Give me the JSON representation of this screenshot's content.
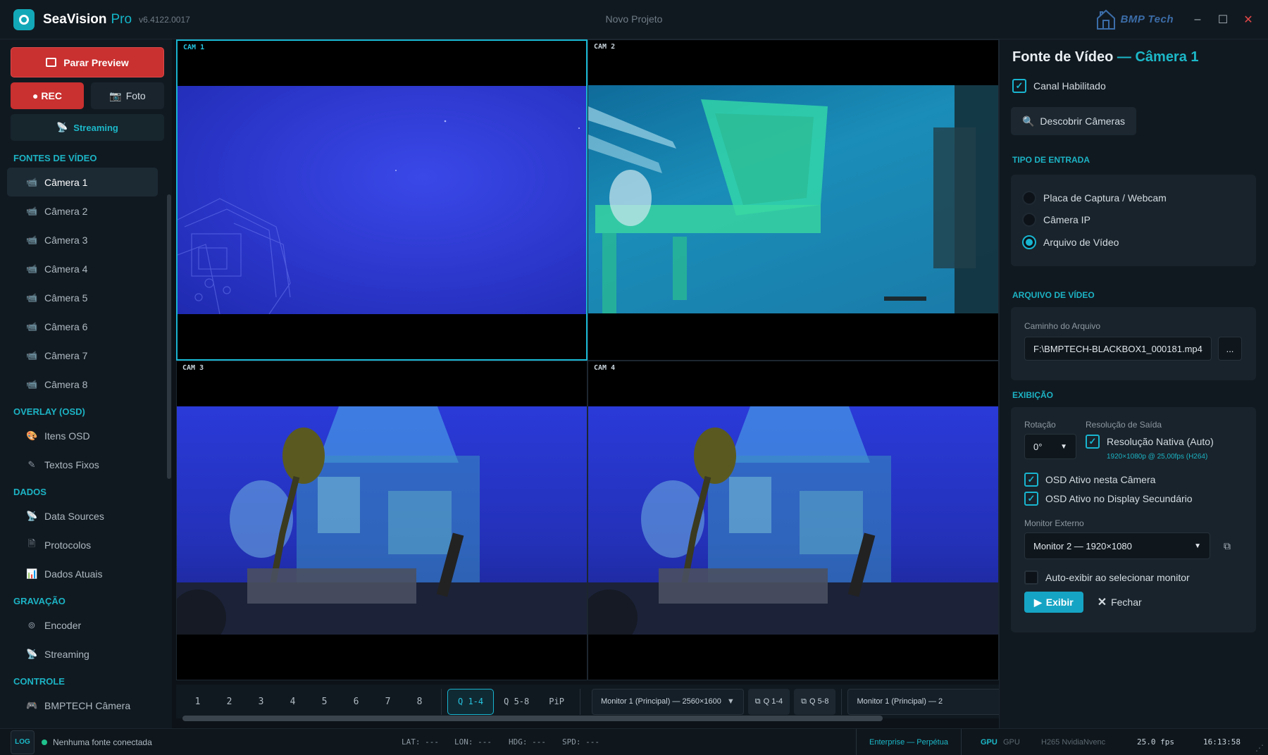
{
  "app": {
    "name": "SeaVision",
    "edition": "Pro",
    "version": "v6.4122.0017",
    "window_title": "Novo Projeto",
    "brand": "BMP Tech",
    "accent": "#19b5d0",
    "danger": "#c93030"
  },
  "sidebar": {
    "preview_button": "Parar Preview",
    "rec_button": "● REC",
    "photo_button": "Foto",
    "streaming_button": "Streaming",
    "sections": [
      {
        "title": "FONTES DE VÍDEO",
        "items": [
          {
            "label": "Câmera 1",
            "icon": "camera-icon",
            "active": true
          },
          {
            "label": "Câmera 2",
            "icon": "camera-icon"
          },
          {
            "label": "Câmera 3",
            "icon": "camera-icon"
          },
          {
            "label": "Câmera 4",
            "icon": "camera-icon"
          },
          {
            "label": "Câmera 5",
            "icon": "camera-icon"
          },
          {
            "label": "Câmera 6",
            "icon": "camera-icon"
          },
          {
            "label": "Câmera 7",
            "icon": "camera-icon"
          },
          {
            "label": "Câmera 8",
            "icon": "camera-icon"
          }
        ]
      },
      {
        "title": "OVERLAY (OSD)",
        "items": [
          {
            "label": "Itens OSD",
            "icon": "palette-icon"
          },
          {
            "label": "Textos Fixos",
            "icon": "pencil-icon"
          }
        ]
      },
      {
        "title": "DADOS",
        "items": [
          {
            "label": "Data Sources",
            "icon": "satellite-icon"
          },
          {
            "label": "Protocolos",
            "icon": "document-icon"
          },
          {
            "label": "Dados Atuais",
            "icon": "chart-icon"
          }
        ]
      },
      {
        "title": "GRAVAÇÃO",
        "items": [
          {
            "label": "Encoder",
            "icon": "encoder-icon"
          },
          {
            "label": "Streaming",
            "icon": "satellite-icon"
          }
        ]
      },
      {
        "title": "CONTROLE",
        "items": [
          {
            "label": "BMPTECH Câmera",
            "icon": "gamepad-icon"
          }
        ]
      }
    ]
  },
  "grid": {
    "cams": [
      {
        "label": "CAM 1",
        "selected": true
      },
      {
        "label": "CAM 2"
      },
      {
        "label": "CAM 3"
      },
      {
        "label": "CAM 4"
      }
    ]
  },
  "toolbar": {
    "pages": [
      "1",
      "2",
      "3",
      "4",
      "5",
      "6",
      "7",
      "8"
    ],
    "q14": "Q 1-4",
    "q58": "Q 5-8",
    "pip": "PiP",
    "monitor_select": "Monitor 1 (Principal) — 2560×1600",
    "btn_q14": "Q 1-4",
    "btn_q58": "Q 5-8",
    "monitor_select2": "Monitor 1 (Principal) — 2"
  },
  "panel": {
    "title": "Fonte de Vídeo",
    "title_highlight": "— Câmera 1",
    "channel_enabled": "Canal Habilitado",
    "discover_button": "Descobrir Câmeras",
    "input_type_title": "TIPO DE ENTRADA",
    "input_types": [
      "Placa de Captura / Webcam",
      "Câmera IP",
      "Arquivo de Vídeo"
    ],
    "selected_input": 2,
    "video_file_title": "ARQUIVO DE VÍDEO",
    "file_path_label": "Caminho do Arquivo",
    "file_path": "F:\\BMPTECH-BLACKBOX1_000181.mp4",
    "browse_button": "...",
    "display_title": "EXIBIÇÃO",
    "rotation_label": "Rotação",
    "rotation_value": "0°",
    "resolution_label": "Resolução de Saída",
    "native_resolution": "Resolução Nativa (Auto)",
    "native_detail": "1920×1080p @ 25,00fps (H264)",
    "osd_camera": "OSD Ativo nesta Câmera",
    "osd_secondary": "OSD Ativo no Display Secundário",
    "external_monitor_label": "Monitor Externo",
    "external_monitor": "Monitor 2 — 1920×1080",
    "auto_show": "Auto-exibir ao selecionar monitor",
    "show_button": "Exibir",
    "close_button": "Fechar"
  },
  "status": {
    "log": "LOG",
    "connection": "Nenhuma fonte conectada",
    "lat": "LAT: ---",
    "lon": "LON: ---",
    "hdg": "HDG: ---",
    "spd": "SPD: ---",
    "license": "Enterprise — Perpétua",
    "gpu1": "GPU",
    "gpu2": "GPU",
    "encoder": "H265 NvidiaNvenc",
    "fps": "25.0 fps",
    "clock": "16:13:58"
  }
}
